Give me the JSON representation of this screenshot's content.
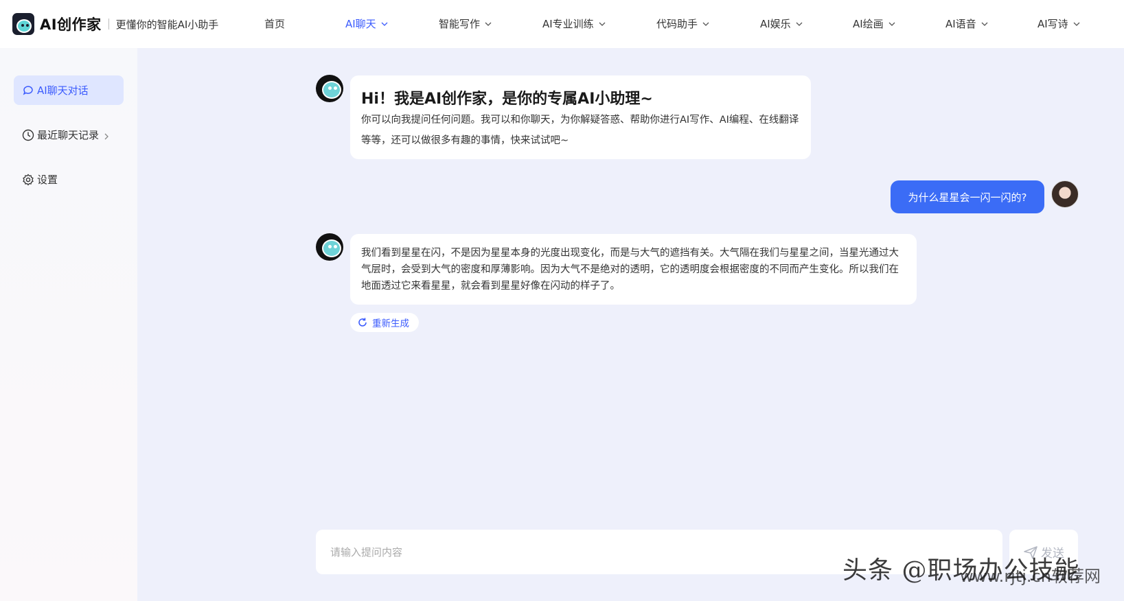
{
  "header": {
    "brand_name": "AI创作家",
    "brand_slogan": "更懂你的智能AI小助手",
    "nav": [
      {
        "label": "首页",
        "has_dropdown": false,
        "active": false
      },
      {
        "label": "AI聊天",
        "has_dropdown": true,
        "active": true
      },
      {
        "label": "智能写作",
        "has_dropdown": true,
        "active": false
      },
      {
        "label": "AI专业训练",
        "has_dropdown": true,
        "active": false
      },
      {
        "label": "代码助手",
        "has_dropdown": true,
        "active": false
      },
      {
        "label": "AI娱乐",
        "has_dropdown": true,
        "active": false
      },
      {
        "label": "AI绘画",
        "has_dropdown": true,
        "active": false
      },
      {
        "label": "AI语音",
        "has_dropdown": true,
        "active": false
      },
      {
        "label": "AI写诗",
        "has_dropdown": true,
        "active": false
      }
    ]
  },
  "sidebar": {
    "items": [
      {
        "label": "AI聊天对话",
        "icon": "chat-bubble-icon",
        "active": true
      },
      {
        "label": "最近聊天记录",
        "icon": "clock-icon",
        "active": false
      },
      {
        "label": "设置",
        "icon": "gear-icon",
        "active": false
      }
    ]
  },
  "chat": {
    "greeting": {
      "title": "Hi！我是AI创作家，是你的专属AI小助理~",
      "body": "你可以向我提问任何问题。我可以和你聊天，为你解疑答惑、帮助你进行AI写作、AI编程、在线翻译等等，还可以做很多有趣的事情，快来试试吧~"
    },
    "user_message": "为什么星星会一闪一闪的?",
    "bot_reply": "我们看到星星在闪，不是因为星星本身的光度出现变化，而是与大气的遮挡有关。大气隔在我们与星星之间，当星光通过大气层时，会受到大气的密度和厚薄影响。因为大气不是绝对的透明，它的透明度会根据密度的不同而产生变化。所以我们在地面透过它来看星星，就会看到星星好像在闪动的样子了。",
    "regenerate_label": "重新生成"
  },
  "composer": {
    "placeholder": "请输入提问内容",
    "send_label": "发送"
  },
  "watermark": {
    "text": "头条 @职场办公技能",
    "site": "www.rjtj.cn软荐网"
  },
  "colors": {
    "accent": "#3b5bfd",
    "user_bubble": "#3b6cf6",
    "page_bg": "#eef0fb"
  }
}
